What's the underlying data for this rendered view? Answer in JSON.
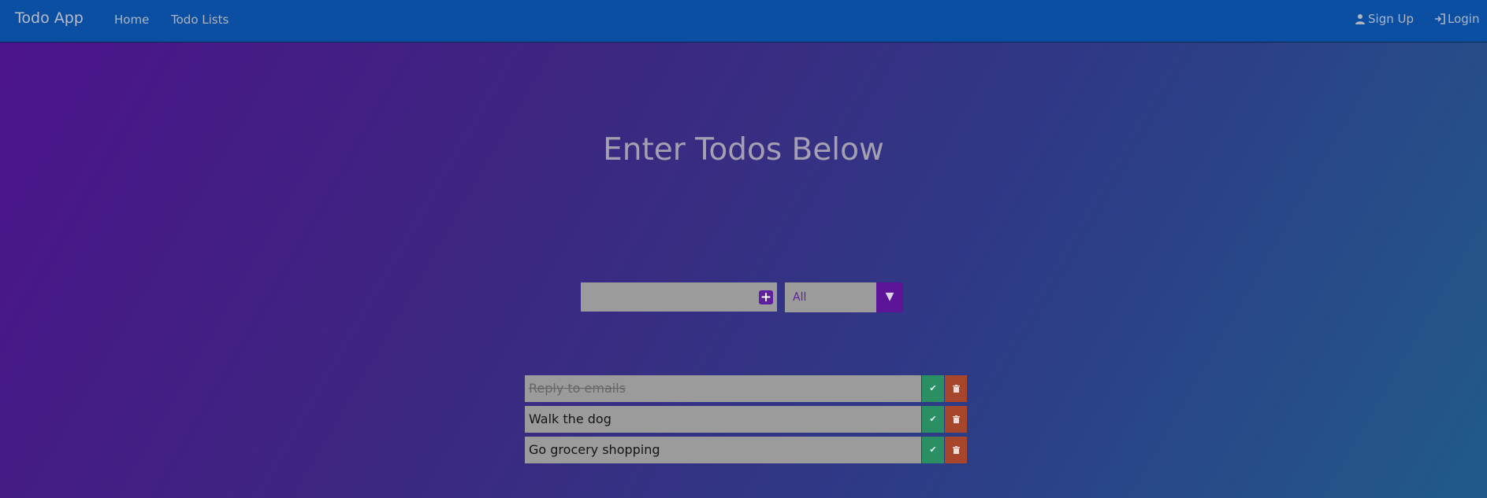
{
  "navbar": {
    "brand": "Todo App",
    "links": [
      "Home",
      "Todo Lists"
    ],
    "signup": "Sign Up",
    "login": "Login"
  },
  "main": {
    "heading": "Enter Todos Below"
  },
  "form": {
    "input_value": "",
    "add_icon": "plus-square-icon",
    "filter_selected": "All",
    "filter_icon": "caret-down-icon"
  },
  "todos": [
    {
      "text": "Reply to emails",
      "completed": true
    },
    {
      "text": "Walk the dog",
      "completed": false
    },
    {
      "text": "Go grocery shopping",
      "completed": false
    }
  ],
  "colors": {
    "navbar": "#0b4fa3",
    "accent": "#5e1fa0",
    "check": "#2b8f64",
    "trash": "#a8462b"
  }
}
